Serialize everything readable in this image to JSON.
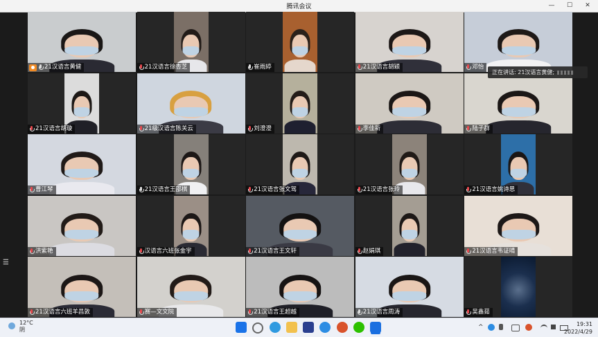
{
  "window": {
    "title": "腾讯会议",
    "minimize_label": "—",
    "maximize_label": "☐",
    "close_label": "✕"
  },
  "speaker_tip": {
    "label": "正在讲话: 21汉语言黄健;"
  },
  "tiles": [
    {
      "name": "21汉语言黄健",
      "host": true,
      "muted": false,
      "layout": "full",
      "bg": "#c9ccce",
      "shirt": "#2a2a33",
      "hair": "#1a1716",
      "speaking": true
    },
    {
      "name": "21汉语言徐杏芝",
      "host": false,
      "muted": true,
      "layout": "mid",
      "bg": "#7b6f66",
      "shirt": "#e7e7ea",
      "hair": "#211b18"
    },
    {
      "name": "崔雨婷",
      "host": false,
      "muted": false,
      "layout": "mid",
      "bg": "#a8602f",
      "shirt": "#e5d7cc",
      "hair": "#2a211b"
    },
    {
      "name": "21汉语言胡颖",
      "host": false,
      "muted": true,
      "layout": "full",
      "bg": "#d7d3cf",
      "shirt": "#30303a",
      "hair": "#1d1817"
    },
    {
      "name": "邓怡",
      "host": false,
      "muted": true,
      "layout": "full",
      "bg": "#c6cdd8",
      "shirt": "#f2f2f4",
      "hair": "#1e1917"
    },
    {
      "name": "21汉语言胡璇",
      "host": false,
      "muted": true,
      "layout": "mid",
      "bg": "#dcdcdc",
      "shirt": "#202027",
      "hair": "#1c1816"
    },
    {
      "name": "21级汉语言陈关云",
      "host": false,
      "muted": true,
      "layout": "full",
      "bg": "#cfd6df",
      "shirt": "#3b3b45",
      "hair": "#d8a040"
    },
    {
      "name": "刘澄澄",
      "host": false,
      "muted": true,
      "layout": "mid",
      "bg": "#b5b09c",
      "shirt": "#1f2030",
      "hair": "#231c18"
    },
    {
      "name": "李佳新",
      "host": false,
      "muted": true,
      "layout": "full",
      "bg": "#cfcac2",
      "shirt": "#2d2d36",
      "hair": "#1b1716"
    },
    {
      "name": "陆子群",
      "host": false,
      "muted": true,
      "layout": "full",
      "bg": "#d9d6cf",
      "shirt": "#26262e",
      "hair": "#1b1716"
    },
    {
      "name": "曹江琴",
      "host": false,
      "muted": true,
      "layout": "full",
      "bg": "#d4d8e0",
      "shirt": "#e9e9ef",
      "hair": "#201a18"
    },
    {
      "name": "21汉语言王邵棋",
      "host": false,
      "muted": false,
      "layout": "mid",
      "bg": "#85807a",
      "shirt": "#f0f0f2",
      "hair": "#1c1716"
    },
    {
      "name": "21汉语言张文驾",
      "host": false,
      "muted": true,
      "layout": "mid",
      "bg": "#bdb8ae",
      "shirt": "#27273a",
      "hair": "#1e1917"
    },
    {
      "name": "21汉语言张玲",
      "host": false,
      "muted": true,
      "layout": "mid",
      "bg": "#8c837a",
      "shirt": "#e8e8ec",
      "hair": "#201a17"
    },
    {
      "name": "21汉语言姚诗思",
      "host": false,
      "muted": true,
      "layout": "mid",
      "bg": "#2d6fa8",
      "shirt": "#30303a",
      "hair": "#1a1615"
    },
    {
      "name": "洪紫艳",
      "host": false,
      "muted": true,
      "layout": "full",
      "bg": "#c9c6c3",
      "shirt": "#dcdce2",
      "hair": "#221b18"
    },
    {
      "name": "汉语言六班张金宇",
      "host": false,
      "muted": true,
      "layout": "mid",
      "bg": "#9b8f86",
      "shirt": "#2a2a33",
      "hair": "#1c1716"
    },
    {
      "name": "21汉语言王文轩",
      "host": false,
      "muted": true,
      "layout": "full",
      "bg": "#555a62",
      "shirt": "#3a3a44",
      "hair": "#141212"
    },
    {
      "name": "赵娟琪",
      "host": false,
      "muted": true,
      "layout": "mid",
      "bg": "#a49d93",
      "shirt": "#22222c",
      "hair": "#1d1817"
    },
    {
      "name": "21汉语言韦证晴",
      "host": false,
      "muted": true,
      "layout": "full",
      "bg": "#e8dfd6",
      "shirt": "#e6e1dc",
      "hair": "#1d1817"
    },
    {
      "name": "21汉语言六班羊昌敦",
      "host": false,
      "muted": true,
      "layout": "full",
      "bg": "#c4bfb9",
      "shirt": "#2b2b36",
      "hair": "#1c1716"
    },
    {
      "name": "赛—文文院",
      "host": false,
      "muted": true,
      "layout": "full",
      "bg": "#d3d1cd",
      "shirt": "#e8e8ea",
      "hair": "#221b18"
    },
    {
      "name": "21汉语言王超越",
      "host": false,
      "muted": true,
      "layout": "full",
      "bg": "#bcbcbc",
      "shirt": "#1f1f27",
      "hair": "#161313"
    },
    {
      "name": "21汉语言周涛",
      "host": false,
      "muted": false,
      "layout": "full",
      "bg": "#d6dbe3",
      "shirt": "#26262e",
      "hair": "#1a1615"
    },
    {
      "name": "吴鑫茹",
      "host": false,
      "muted": true,
      "layout": "mid",
      "bg": "#0f2a4a",
      "shirt": "#0f2a4a",
      "hair": "#0f2a4a",
      "nobody": true
    }
  ],
  "taskbar": {
    "weather_temp": "12°C",
    "weather_desc": "阴",
    "time": "19:31",
    "date": "2022/4/29",
    "chevron_label": "^",
    "colors": {
      "start": "#1a73e8",
      "search": "#666666",
      "edge": "#2f9ae0",
      "explorer": "#f2c14e",
      "store": "#2a3f8f",
      "browser": "#2d8de3",
      "office": "#d9532c",
      "wechat": "#2dc100",
      "meeting": "#1a6fe0"
    }
  }
}
